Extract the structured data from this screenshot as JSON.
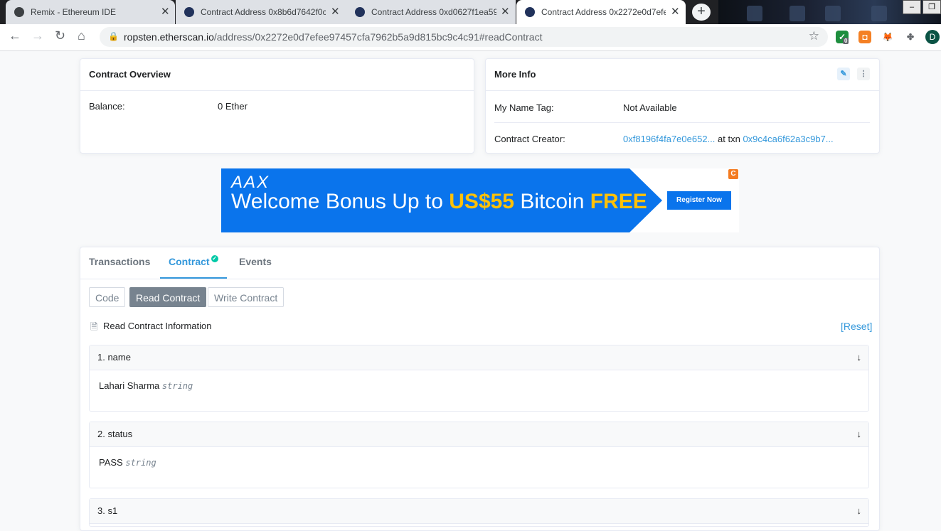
{
  "browser": {
    "tabs": [
      {
        "title": "Remix - Ethereum IDE",
        "active": false
      },
      {
        "title": "Contract Address 0x8b6d7642f0c",
        "active": false
      },
      {
        "title": "Contract Address 0xd0627f1ea59",
        "active": false
      },
      {
        "title": "Contract Address 0x2272e0d7efe",
        "active": true
      }
    ],
    "url_host": "ropsten.etherscan.io",
    "url_path": "/address/0x2272e0d7efee97457cfa7962b5a9d815bc9c4c91#readContract",
    "extension_badge": "0",
    "profile_initial": "D"
  },
  "overview": {
    "title": "Contract Overview",
    "balance_label": "Balance:",
    "balance_value": "0 Ether"
  },
  "more_info": {
    "title": "More Info",
    "name_tag_label": "My Name Tag:",
    "name_tag_value": "Not Available",
    "creator_label": "Contract Creator:",
    "creator_address": "0xf8196f4fa7e0e652...",
    "at_txn": "at txn",
    "creator_txn": "0x9c4ca6f62a3c9b7..."
  },
  "ad": {
    "brand": "AAX",
    "text_part1": "Welcome Bonus Up to ",
    "amount": "US$55",
    "text_part2": " Bitcoin ",
    "free": "FREE",
    "cta": "Register Now",
    "corner": "C"
  },
  "contract_tabs": {
    "transactions": "Transactions",
    "contract": "Contract",
    "events": "Events"
  },
  "subtabs": {
    "code": "Code",
    "read": "Read Contract",
    "write": "Write Contract"
  },
  "read_info": {
    "title": "Read Contract Information",
    "reset": "[Reset]"
  },
  "functions": [
    {
      "header": "1. name",
      "value": "Lahari Sharma",
      "type": "string"
    },
    {
      "header": "2. status",
      "value": "PASS",
      "type": "string"
    },
    {
      "header": "3. s1",
      "value": "",
      "type": ""
    }
  ],
  "colors": {
    "link": "#3498db",
    "ad_blue": "#0a74ec",
    "ad_yellow": "#ffc107",
    "verified": "#00c9a7"
  }
}
